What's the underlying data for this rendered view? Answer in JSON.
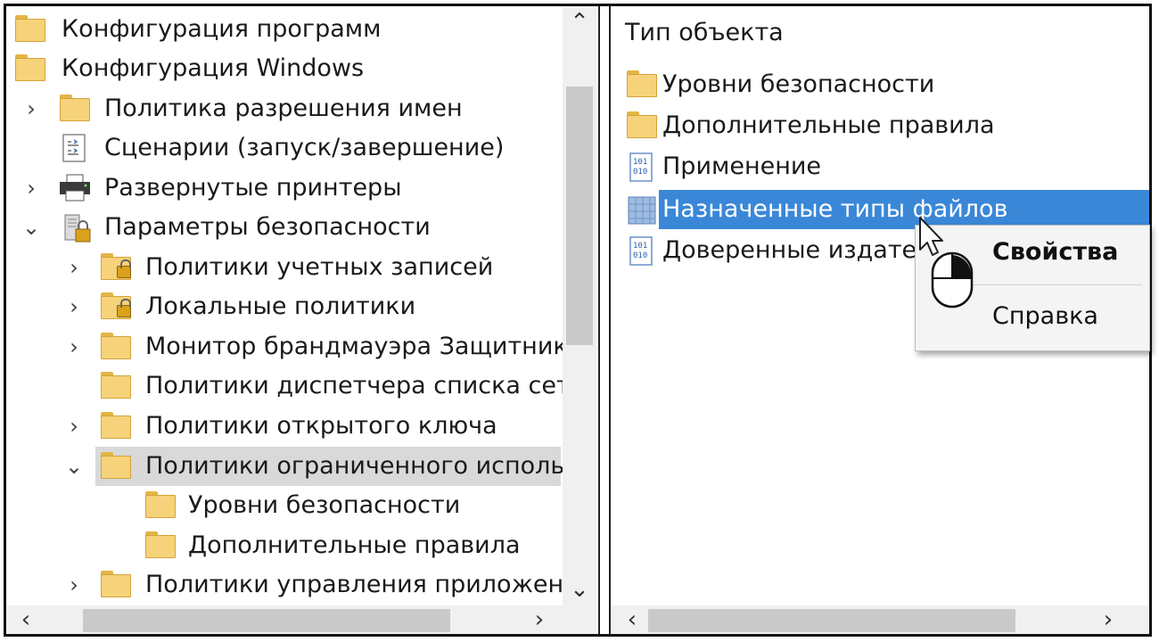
{
  "left_tree": {
    "items": [
      {
        "label": "Конфигурация программ",
        "icon": "folder-icon",
        "chevron": ""
      },
      {
        "label": "Конфигурация Windows",
        "icon": "folder-icon",
        "chevron": ""
      },
      {
        "label": "Политика разрешения имен",
        "icon": "folder-icon",
        "chevron": "›"
      },
      {
        "label": "Сценарии (запуск/завершение)",
        "icon": "script-icon",
        "chevron": ""
      },
      {
        "label": "Развернутые принтеры",
        "icon": "printer-icon",
        "chevron": "›"
      },
      {
        "label": "Параметры безопасности",
        "icon": "security-settings-icon",
        "chevron": "⌄"
      },
      {
        "label": "Политики учетных записей",
        "icon": "locked-folder-icon",
        "chevron": "›"
      },
      {
        "label": "Локальные политики",
        "icon": "locked-folder-icon",
        "chevron": "›"
      },
      {
        "label": "Монитор брандмауэра Защитника",
        "icon": "folder-icon",
        "chevron": "›"
      },
      {
        "label": "Политики диспетчера списка сете",
        "icon": "folder-icon",
        "chevron": ""
      },
      {
        "label": "Политики открытого ключа",
        "icon": "folder-icon",
        "chevron": "›"
      },
      {
        "label": "Политики ограниченного использ",
        "icon": "folder-icon",
        "chevron": "⌄",
        "selected": true
      },
      {
        "label": "Уровни безопасности",
        "icon": "folder-icon",
        "chevron": ""
      },
      {
        "label": "Дополнительные правила",
        "icon": "folder-icon",
        "chevron": ""
      },
      {
        "label": "Политики управления приложени",
        "icon": "folder-icon",
        "chevron": "›"
      }
    ]
  },
  "right_pane": {
    "header": "Тип объекта",
    "items": [
      {
        "label": "Уровни безопасности",
        "icon": "folder-icon"
      },
      {
        "label": "Дополнительные правила",
        "icon": "folder-icon"
      },
      {
        "label": "Применение",
        "icon": "binary-policy-icon"
      },
      {
        "label": "Назначенные типы файлов",
        "icon": "file-types-icon",
        "selected": true
      },
      {
        "label": "Доверенные издатели",
        "icon": "binary-policy-icon"
      }
    ]
  },
  "context_menu": {
    "properties": "Свойства",
    "help": "Справка"
  },
  "colors": {
    "selection": "#3a87d8",
    "tree_selection": "#d9d9d9",
    "folder": "#f6d27a"
  }
}
